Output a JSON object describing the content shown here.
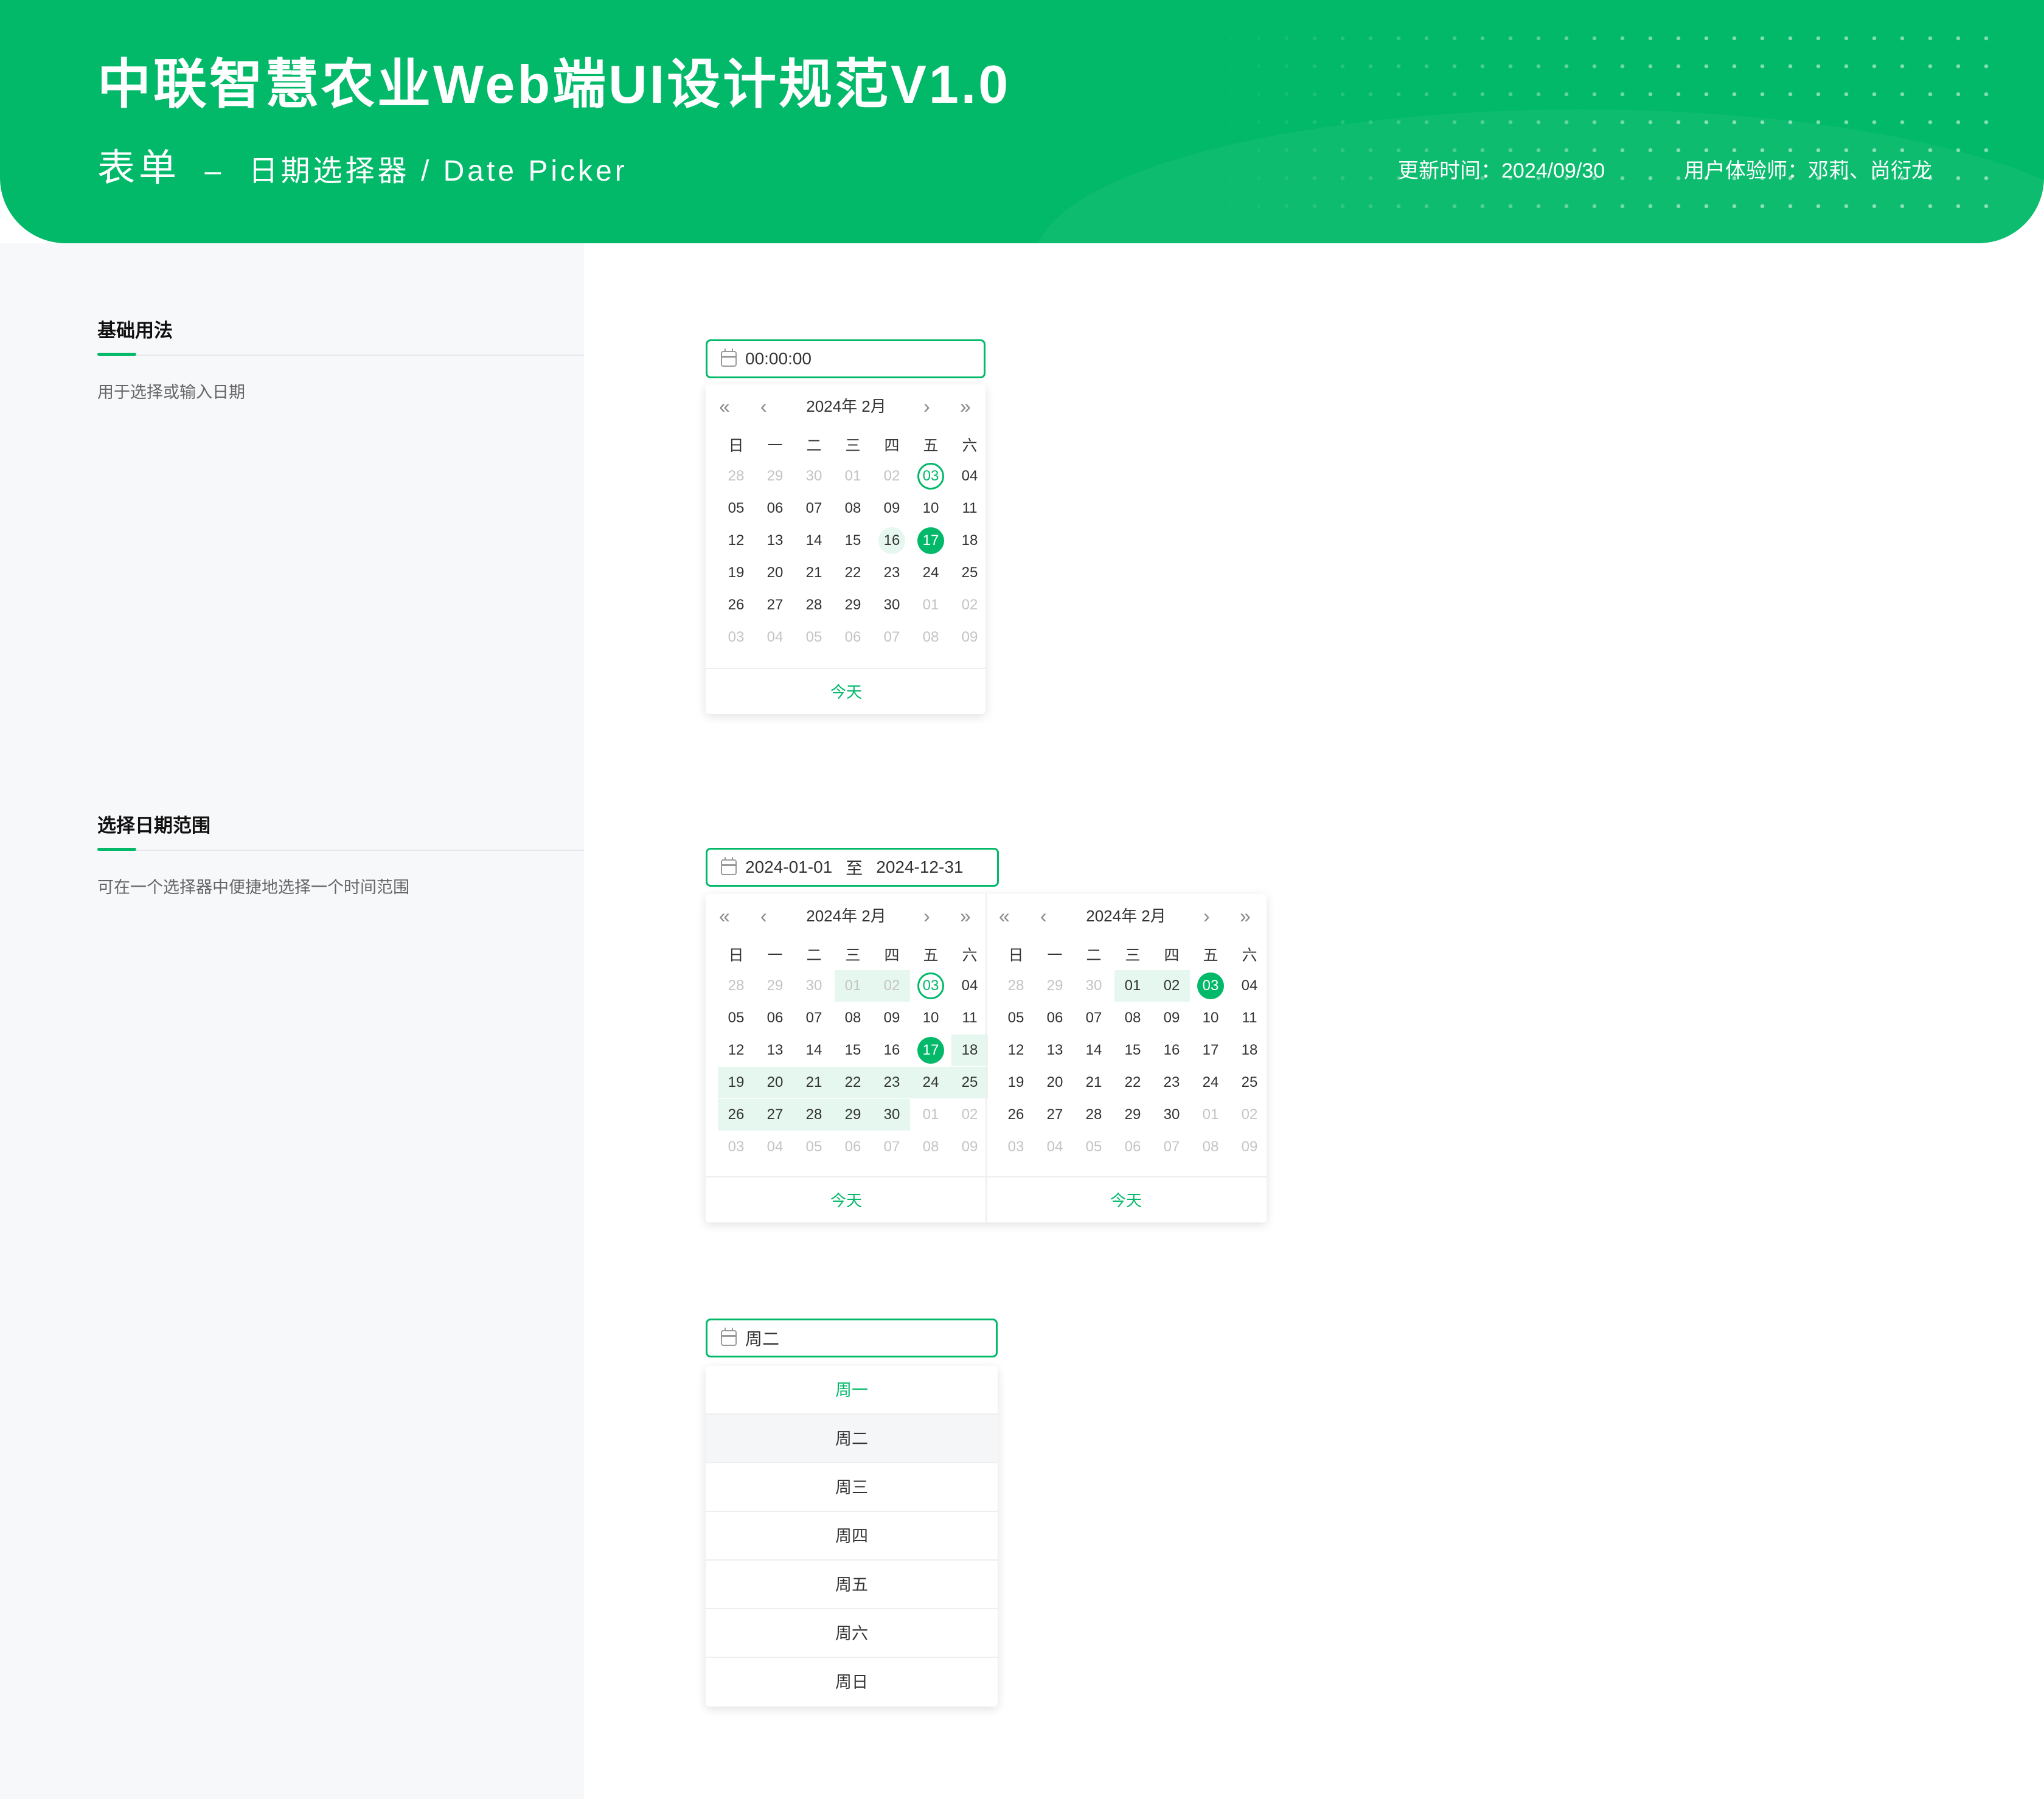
{
  "header": {
    "title": "中联智慧农业Web端UI设计规范V1.0",
    "category": "表单",
    "dash": "–",
    "component": "日期选择器 / Date Picker",
    "updated": "更新时间：2024/09/30",
    "designers": "用户体验师：邓莉、尚衍龙"
  },
  "colors": {
    "brand": "#02b969",
    "range": "#e6f7ef",
    "panel_bg": "#f7f8fa"
  },
  "sections": [
    {
      "title": "基础用法",
      "desc": "用于选择或输入日期"
    },
    {
      "title": "选择日期范围",
      "desc": "可在一个选择器中便捷地选择一个时间范围"
    }
  ],
  "calendar": {
    "weekdays": [
      "日",
      "一",
      "二",
      "三",
      "四",
      "五",
      "六"
    ],
    "rows": [
      [
        "28",
        "29",
        "30",
        "01",
        "02",
        "03",
        "04"
      ],
      [
        "05",
        "06",
        "07",
        "08",
        "09",
        "10",
        "11"
      ],
      [
        "12",
        "13",
        "14",
        "15",
        "16",
        "17",
        "18"
      ],
      [
        "19",
        "20",
        "21",
        "22",
        "23",
        "24",
        "25"
      ],
      [
        "26",
        "27",
        "28",
        "29",
        "30",
        "01",
        "02"
      ],
      [
        "03",
        "04",
        "05",
        "06",
        "07",
        "08",
        "09"
      ]
    ],
    "nav_prev_year": "«",
    "nav_prev_month": "‹",
    "nav_next_month": "›",
    "nav_next_year": "»",
    "today": "今天"
  },
  "basic": {
    "input_value": "00:00:00",
    "month_label": "2024年  2月",
    "today_cell": "03",
    "selected": "17",
    "hover": "16"
  },
  "range": {
    "start": "2024-01-01",
    "separator": "至",
    "end": "2024-12-31",
    "left": {
      "month_label": "2024年  2月",
      "today_cell": "03",
      "selected": "17"
    },
    "right": {
      "month_label": "2024年  2月",
      "selected": "03"
    }
  },
  "weekpick": {
    "input_value": "周二",
    "options": [
      "周一",
      "周二",
      "周三",
      "周四",
      "周五",
      "周六",
      "周日"
    ],
    "active": "周一",
    "hovered": "周二"
  }
}
